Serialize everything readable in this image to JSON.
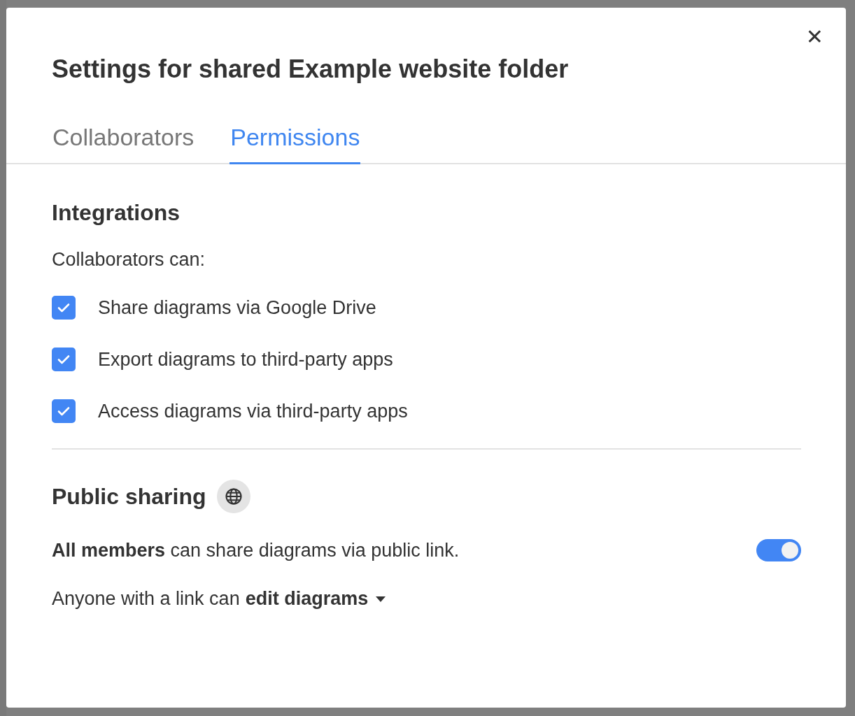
{
  "dialog": {
    "title": "Settings for shared Example website folder",
    "close_label": "✕"
  },
  "tabs": [
    {
      "label": "Collaborators",
      "selected": false
    },
    {
      "label": "Permissions",
      "selected": true
    }
  ],
  "integrations": {
    "heading": "Integrations",
    "intro": "Collaborators can:",
    "options": [
      {
        "label": "Share diagrams via Google Drive",
        "checked": true
      },
      {
        "label": "Export diagrams to third-party apps",
        "checked": true
      },
      {
        "label": "Access diagrams via third-party apps",
        "checked": true
      }
    ]
  },
  "public_sharing": {
    "heading": "Public sharing",
    "sharing_text": "**All members** can share diagrams via public link.",
    "sharing_on": true,
    "link_text": "Anyone with a link can",
    "link_permission": "edit diagrams"
  }
}
